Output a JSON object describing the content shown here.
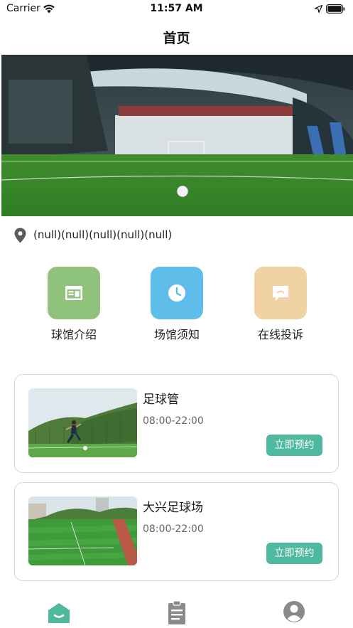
{
  "status_bar": {
    "carrier": "Carrier",
    "time": "11:57 AM",
    "icons": [
      "wifi-icon",
      "location-arrow-icon",
      "battery-icon"
    ]
  },
  "nav": {
    "title": "首页"
  },
  "hero": {
    "image": "indoor football pitch with a ball on the grass"
  },
  "address": {
    "icon": "location-pin-icon",
    "text": "(null)(null)(null)(null)(null)"
  },
  "features": [
    {
      "label": "球馆介绍",
      "icon": "browser-window-icon",
      "color": "#8fc37c"
    },
    {
      "label": "场馆须知",
      "icon": "clock-icon",
      "color": "#5fbde9"
    },
    {
      "label": "在线投诉",
      "icon": "chat-bubble-icon",
      "color": "#f1d2a5"
    }
  ],
  "venues": [
    {
      "name": "足球管",
      "hours": "08:00-22:00",
      "button": "立即预约",
      "image": "player kicking a ball on a pitch"
    },
    {
      "name": "大兴足球场",
      "hours": "08:00-22:00",
      "button": "立即预约",
      "image": "outdoor football field with running track"
    }
  ],
  "tab_bar": {
    "items": [
      {
        "name": "home",
        "icon": "home-icon",
        "active": true
      },
      {
        "name": "orders",
        "icon": "clipboard-icon",
        "active": false
      },
      {
        "name": "profile",
        "icon": "user-icon",
        "active": false
      }
    ],
    "active_color": "#4fb9a0",
    "inactive_color": "#8a8a8a"
  },
  "colors": {
    "accent": "#4fb9a0",
    "card_border": "#d9d9d9"
  }
}
